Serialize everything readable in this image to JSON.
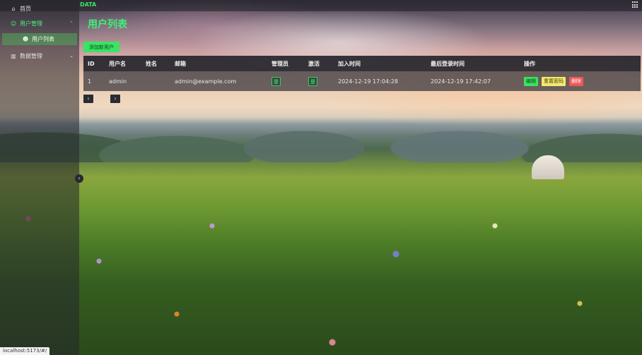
{
  "header": {
    "brand": "DATA",
    "grid_icon": "grid-icon"
  },
  "sidebar": {
    "items": [
      {
        "label": "首页",
        "icon": "home-icon"
      },
      {
        "label": "用户管理",
        "icon": "users-icon",
        "expanded": true
      },
      {
        "label": "用户列表",
        "icon": "user-group-icon",
        "active": true
      },
      {
        "label": "数据管理",
        "icon": "chart-icon",
        "expanded": false
      }
    ],
    "collapse_icon": "chevron-left-icon"
  },
  "main": {
    "title": "用户列表",
    "add_button": "添加新用户",
    "table": {
      "columns": [
        "ID",
        "用户名",
        "姓名",
        "邮箱",
        "管理员",
        "激活",
        "加入时间",
        "最后登录时间",
        "操作"
      ],
      "rows": [
        {
          "id": "1",
          "username": "admin",
          "name": "",
          "email": "admin@example.com",
          "admin": "是",
          "active": "是",
          "joined": "2024-12-19 17:04:28",
          "last_login": "2024-12-19 17:42:07",
          "actions": {
            "edit": "编辑",
            "reset": "重置密码",
            "delete": "删除"
          }
        }
      ]
    },
    "pagination": {
      "prev": "‹",
      "next": "›"
    }
  },
  "status": {
    "url": "localhost:5173/#/"
  },
  "colors": {
    "accent": "#3ff07a",
    "edit": "#38e35f",
    "reset": "#f4e96d",
    "delete": "#f05656"
  }
}
